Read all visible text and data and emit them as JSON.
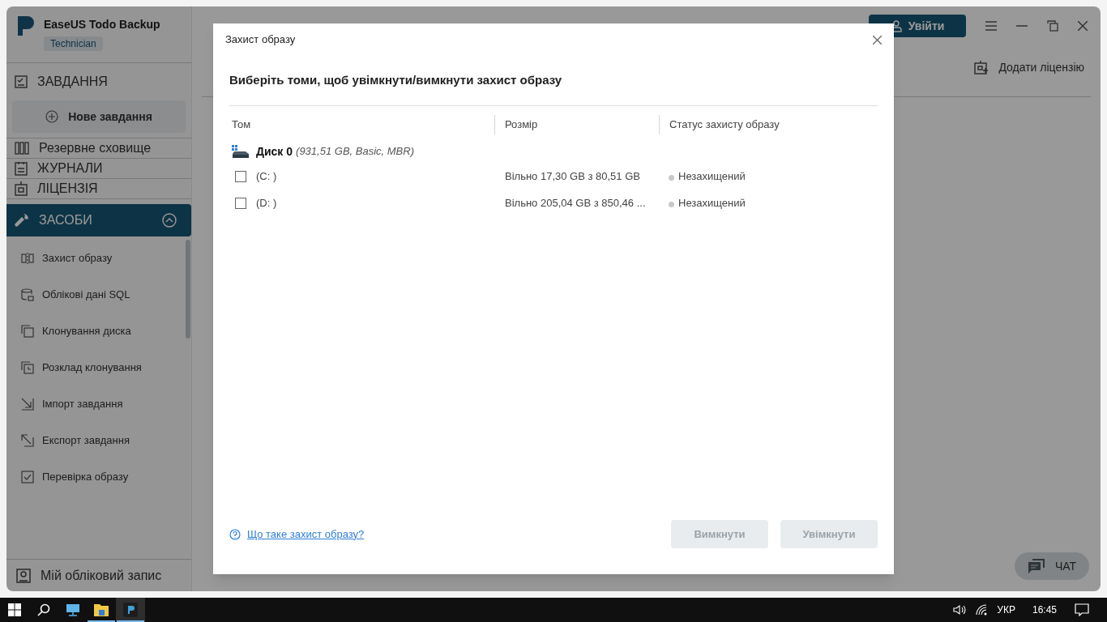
{
  "app": {
    "title": "EaseUS Todo Backup",
    "edition": "Technician",
    "login_button": "Увійти",
    "add_license": "Додати ліцензію",
    "chat_button": "ЧАТ"
  },
  "sidebar": {
    "items": [
      {
        "kind": "header",
        "label": "ЗАВДАННЯ"
      },
      {
        "kind": "button",
        "label": "Нове завдання"
      },
      {
        "kind": "header",
        "label": "Резервне сховище"
      },
      {
        "kind": "header",
        "label": "ЖУРНАЛИ"
      },
      {
        "kind": "header",
        "label": "ЛІЦЕНЗІЯ"
      },
      {
        "kind": "group",
        "label": "ЗАСОБИ",
        "expanded": true,
        "selected": true
      }
    ],
    "tools": [
      "Захист образу",
      "Облікові дані SQL",
      "Клонування диска",
      "Розклад клонування",
      "Імпорт завдання",
      "Експорт завдання",
      "Перевірка образу"
    ],
    "account": "Мій обліковий запис"
  },
  "dialog": {
    "title": "Захист образу",
    "heading": "Виберіть томи, щоб увімкнути/вимкнути захист образу",
    "columns": [
      "Том",
      "Розмір",
      "Статус захисту образу"
    ],
    "disk": {
      "name": "Диск 0",
      "details": "(931,51 GB, Basic, MBR)"
    },
    "volumes": [
      {
        "name": "(C: )",
        "checked": false,
        "size": "Вільно 17,30 GB з 80,51 GB",
        "status": "Незахищений"
      },
      {
        "name": "(D: )",
        "checked": false,
        "size": "Вільно 205,04 GB з 850,46 ...",
        "status": "Незахищений"
      }
    ],
    "help_link": "Що таке захист образу?",
    "buttons": [
      {
        "label": "Вимкнути",
        "disabled": true
      },
      {
        "label": "Увімкнути",
        "disabled": true
      }
    ]
  },
  "taskbar": {
    "apps": [
      {
        "running": true,
        "selected": false
      },
      {
        "running": true,
        "selected": true
      }
    ],
    "language": "УКР",
    "time": "16:45"
  }
}
